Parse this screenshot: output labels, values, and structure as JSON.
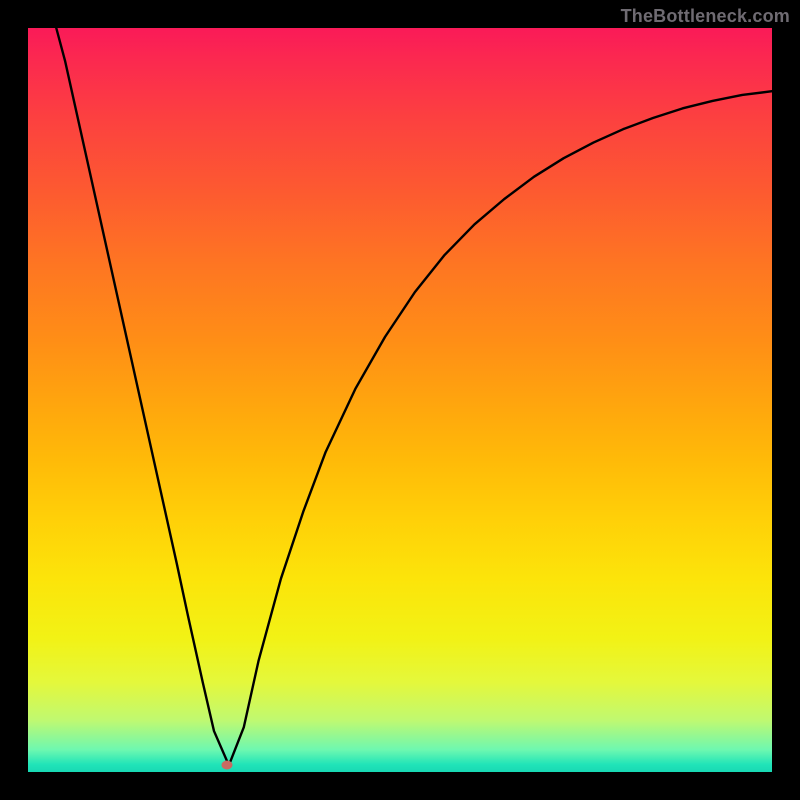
{
  "watermark": "TheBottleneck.com",
  "chart_data": {
    "type": "line",
    "title": "",
    "xlabel": "",
    "ylabel": "",
    "xlim": [
      0,
      100
    ],
    "ylim": [
      0,
      100
    ],
    "grid": false,
    "legend": false,
    "series": [
      {
        "name": "curve",
        "x": [
          3.8,
          5,
          8,
          11,
          14,
          17,
          20,
          21.5,
          23.5,
          25,
          27,
          29,
          31,
          34,
          37,
          40,
          44,
          48,
          52,
          56,
          60,
          64,
          68,
          72,
          76,
          80,
          84,
          88,
          92,
          96,
          100
        ],
        "y": [
          100,
          95.5,
          82,
          68.5,
          55,
          41.5,
          28,
          21,
          12,
          5.5,
          0.9,
          6,
          15,
          26,
          35,
          43,
          51.5,
          58.5,
          64.5,
          69.5,
          73.6,
          77,
          80,
          82.5,
          84.6,
          86.4,
          87.9,
          89.2,
          90.2,
          91,
          91.5
        ]
      }
    ],
    "annotations": [
      {
        "name": "min-marker",
        "x": 26.7,
        "y": 0.9
      }
    ],
    "background_gradient": {
      "top": "#fa1a58",
      "mid": "#ffe009",
      "bottom": "#18d8b4"
    }
  },
  "colors": {
    "curve_stroke": "#000000",
    "dot_fill": "#c96a62",
    "frame": "#000000"
  }
}
